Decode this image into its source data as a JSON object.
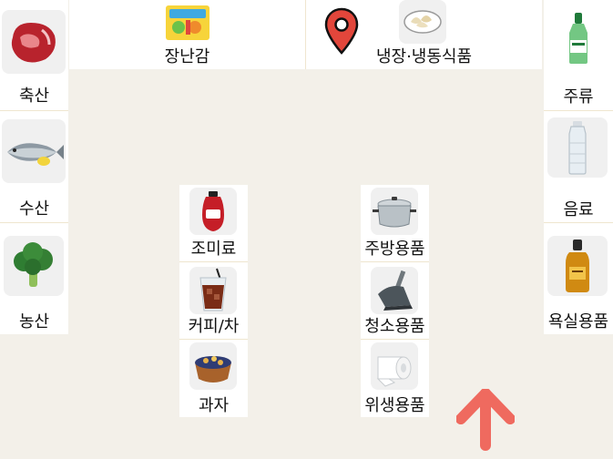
{
  "top": {
    "toys_label": "장난감",
    "frozen_label": "냉장·냉동식품"
  },
  "left": {
    "meat_label": "축산",
    "fish_label": "수산",
    "veg_label": "농산"
  },
  "right": {
    "liquor_label": "주류",
    "drinks_label": "음료",
    "bath_label": "욕실용품"
  },
  "center_left": {
    "seasoning_label": "조미료",
    "coffee_label": "커피/차",
    "snack_label": "과자"
  },
  "center_right": {
    "kitchen_label": "주방용품",
    "cleaning_label": "청소용품",
    "hygiene_label": "위생용품"
  },
  "colors": {
    "background": "#f3f0e9",
    "tile": "#ffffff",
    "thumb": "#f0f0f0",
    "pin": "#e2463b",
    "arrow": "#ef6a5f"
  },
  "icons": {
    "location": "location-pin-icon",
    "direction": "arrow-up-icon"
  }
}
